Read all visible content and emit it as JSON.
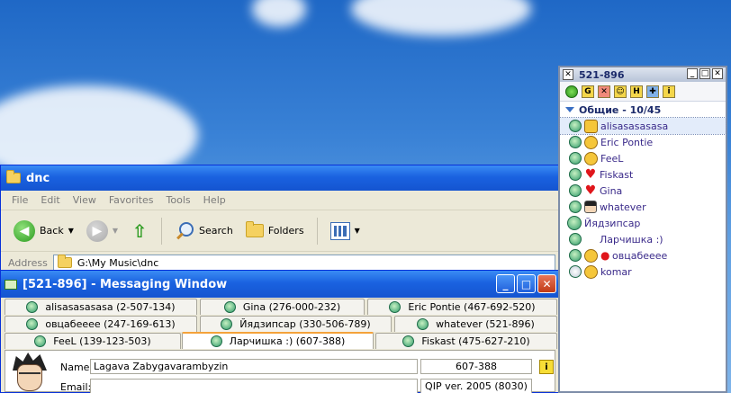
{
  "explorer": {
    "title": "dnc",
    "menu": [
      "File",
      "Edit",
      "View",
      "Favorites",
      "Tools",
      "Help"
    ],
    "toolbar": {
      "back": "Back",
      "search": "Search",
      "folders": "Folders"
    },
    "address_label": "Address",
    "address_value": "G:\\My Music\\dnc"
  },
  "messaging": {
    "title": "[521-896] - Messaging Window",
    "tabs_row1": [
      "alisasasasasa (2-507-134)",
      "Gina (276-000-232)",
      "Eric Pontie (467-692-520)"
    ],
    "tabs_row2": [
      "овцабееее (247-169-613)",
      "Йядзипсар (330-506-789)",
      "whatever (521-896)"
    ],
    "tabs_row3": [
      "FeeL (139-123-503)",
      "Ларчишка :) (607-388)",
      "Fiskast (475-627-210)"
    ],
    "name_label": "Name:",
    "name_value": "Lagava  Zabygavarambyzin",
    "uin_value": "607-388",
    "email_label": "Email:",
    "email_value": "",
    "client_value": "QIP ver. 2005 (8030)",
    "info_icon": "i"
  },
  "contact_list": {
    "title": "521-896",
    "group_header": "Общие - 10/45",
    "toolbar_icons": [
      "status-icon",
      "G",
      "block-icon",
      "group-icon",
      "H",
      "puzzle-icon",
      "i"
    ],
    "contacts": [
      {
        "name": "alisasasasasa",
        "icon": "cup-icon"
      },
      {
        "name": "Eric Pontie",
        "icon": "smile-icon"
      },
      {
        "name": "FeeL",
        "icon": "smile-icon"
      },
      {
        "name": "Fiskast",
        "icon": "heart-icon"
      },
      {
        "name": "Gina",
        "icon": "heart-icon"
      },
      {
        "name": "whatever",
        "icon": "person-icon"
      },
      {
        "name": "Йядзипсар",
        "icon": ""
      },
      {
        "name": "Ларчишка :)",
        "icon": ""
      },
      {
        "name": "овцабееее",
        "icon": "pin-icon"
      },
      {
        "name": "komar",
        "icon": "smile-icon"
      }
    ]
  }
}
